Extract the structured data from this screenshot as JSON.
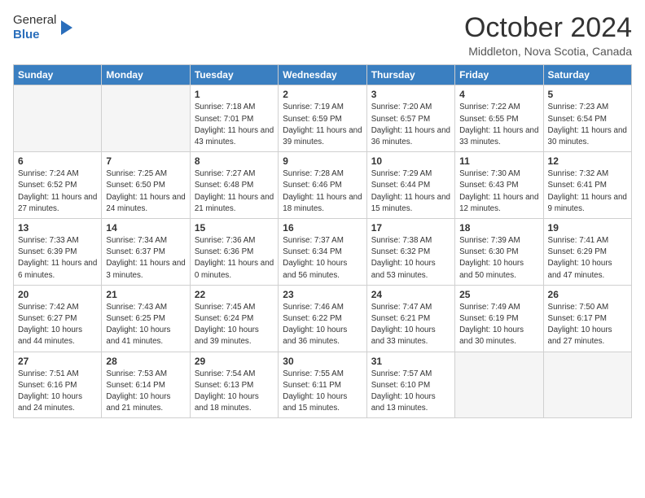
{
  "header": {
    "logo": {
      "line1": "General",
      "line2": "Blue"
    },
    "title": "October 2024",
    "location": "Middleton, Nova Scotia, Canada"
  },
  "weekdays": [
    "Sunday",
    "Monday",
    "Tuesday",
    "Wednesday",
    "Thursday",
    "Friday",
    "Saturday"
  ],
  "weeks": [
    [
      {
        "day": "",
        "info": ""
      },
      {
        "day": "",
        "info": ""
      },
      {
        "day": "1",
        "info": "Sunrise: 7:18 AM\nSunset: 7:01 PM\nDaylight: 11 hours and 43 minutes."
      },
      {
        "day": "2",
        "info": "Sunrise: 7:19 AM\nSunset: 6:59 PM\nDaylight: 11 hours and 39 minutes."
      },
      {
        "day": "3",
        "info": "Sunrise: 7:20 AM\nSunset: 6:57 PM\nDaylight: 11 hours and 36 minutes."
      },
      {
        "day": "4",
        "info": "Sunrise: 7:22 AM\nSunset: 6:55 PM\nDaylight: 11 hours and 33 minutes."
      },
      {
        "day": "5",
        "info": "Sunrise: 7:23 AM\nSunset: 6:54 PM\nDaylight: 11 hours and 30 minutes."
      }
    ],
    [
      {
        "day": "6",
        "info": "Sunrise: 7:24 AM\nSunset: 6:52 PM\nDaylight: 11 hours and 27 minutes."
      },
      {
        "day": "7",
        "info": "Sunrise: 7:25 AM\nSunset: 6:50 PM\nDaylight: 11 hours and 24 minutes."
      },
      {
        "day": "8",
        "info": "Sunrise: 7:27 AM\nSunset: 6:48 PM\nDaylight: 11 hours and 21 minutes."
      },
      {
        "day": "9",
        "info": "Sunrise: 7:28 AM\nSunset: 6:46 PM\nDaylight: 11 hours and 18 minutes."
      },
      {
        "day": "10",
        "info": "Sunrise: 7:29 AM\nSunset: 6:44 PM\nDaylight: 11 hours and 15 minutes."
      },
      {
        "day": "11",
        "info": "Sunrise: 7:30 AM\nSunset: 6:43 PM\nDaylight: 11 hours and 12 minutes."
      },
      {
        "day": "12",
        "info": "Sunrise: 7:32 AM\nSunset: 6:41 PM\nDaylight: 11 hours and 9 minutes."
      }
    ],
    [
      {
        "day": "13",
        "info": "Sunrise: 7:33 AM\nSunset: 6:39 PM\nDaylight: 11 hours and 6 minutes."
      },
      {
        "day": "14",
        "info": "Sunrise: 7:34 AM\nSunset: 6:37 PM\nDaylight: 11 hours and 3 minutes."
      },
      {
        "day": "15",
        "info": "Sunrise: 7:36 AM\nSunset: 6:36 PM\nDaylight: 11 hours and 0 minutes."
      },
      {
        "day": "16",
        "info": "Sunrise: 7:37 AM\nSunset: 6:34 PM\nDaylight: 10 hours and 56 minutes."
      },
      {
        "day": "17",
        "info": "Sunrise: 7:38 AM\nSunset: 6:32 PM\nDaylight: 10 hours and 53 minutes."
      },
      {
        "day": "18",
        "info": "Sunrise: 7:39 AM\nSunset: 6:30 PM\nDaylight: 10 hours and 50 minutes."
      },
      {
        "day": "19",
        "info": "Sunrise: 7:41 AM\nSunset: 6:29 PM\nDaylight: 10 hours and 47 minutes."
      }
    ],
    [
      {
        "day": "20",
        "info": "Sunrise: 7:42 AM\nSunset: 6:27 PM\nDaylight: 10 hours and 44 minutes."
      },
      {
        "day": "21",
        "info": "Sunrise: 7:43 AM\nSunset: 6:25 PM\nDaylight: 10 hours and 41 minutes."
      },
      {
        "day": "22",
        "info": "Sunrise: 7:45 AM\nSunset: 6:24 PM\nDaylight: 10 hours and 39 minutes."
      },
      {
        "day": "23",
        "info": "Sunrise: 7:46 AM\nSunset: 6:22 PM\nDaylight: 10 hours and 36 minutes."
      },
      {
        "day": "24",
        "info": "Sunrise: 7:47 AM\nSunset: 6:21 PM\nDaylight: 10 hours and 33 minutes."
      },
      {
        "day": "25",
        "info": "Sunrise: 7:49 AM\nSunset: 6:19 PM\nDaylight: 10 hours and 30 minutes."
      },
      {
        "day": "26",
        "info": "Sunrise: 7:50 AM\nSunset: 6:17 PM\nDaylight: 10 hours and 27 minutes."
      }
    ],
    [
      {
        "day": "27",
        "info": "Sunrise: 7:51 AM\nSunset: 6:16 PM\nDaylight: 10 hours and 24 minutes."
      },
      {
        "day": "28",
        "info": "Sunrise: 7:53 AM\nSunset: 6:14 PM\nDaylight: 10 hours and 21 minutes."
      },
      {
        "day": "29",
        "info": "Sunrise: 7:54 AM\nSunset: 6:13 PM\nDaylight: 10 hours and 18 minutes."
      },
      {
        "day": "30",
        "info": "Sunrise: 7:55 AM\nSunset: 6:11 PM\nDaylight: 10 hours and 15 minutes."
      },
      {
        "day": "31",
        "info": "Sunrise: 7:57 AM\nSunset: 6:10 PM\nDaylight: 10 hours and 13 minutes."
      },
      {
        "day": "",
        "info": ""
      },
      {
        "day": "",
        "info": ""
      }
    ]
  ]
}
